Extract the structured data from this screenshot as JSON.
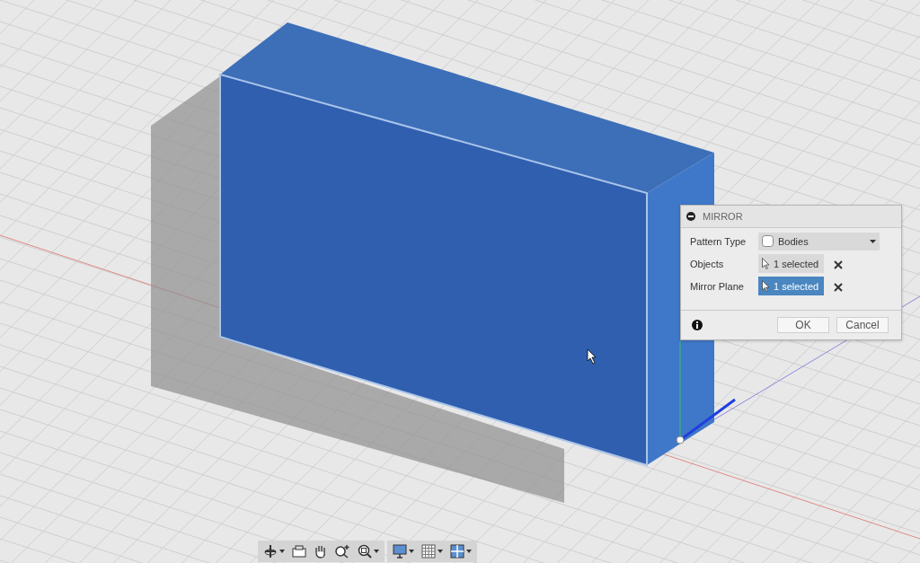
{
  "dialog": {
    "title": "MIRROR",
    "rows": [
      {
        "label": "Pattern Type",
        "kind": "dropdown",
        "value": "Bodies"
      },
      {
        "label": "Objects",
        "kind": "selection",
        "value": "1 selected",
        "selected": false
      },
      {
        "label": "Mirror Plane",
        "kind": "selection",
        "value": "1 selected",
        "selected": true
      }
    ],
    "buttons": [
      "OK",
      "Cancel"
    ]
  }
}
